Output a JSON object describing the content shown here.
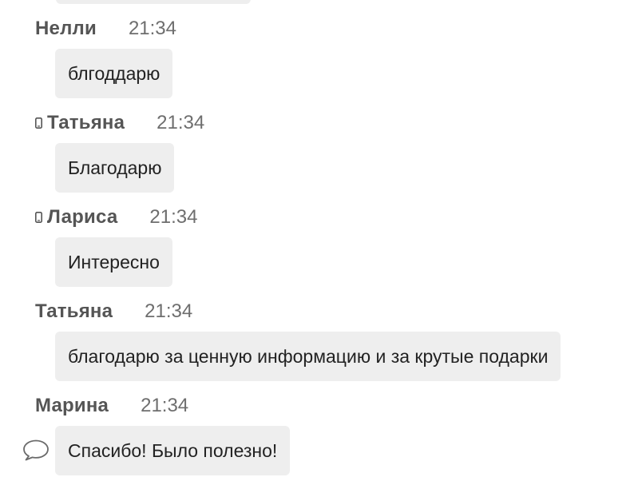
{
  "messages": [
    {
      "author": "Нелли",
      "time": "21:34",
      "text": "блгоддарю",
      "mobile": false
    },
    {
      "author": "Татьяна",
      "time": "21:34",
      "text": "Благодарю",
      "mobile": true
    },
    {
      "author": "Лариса",
      "time": "21:34",
      "text": "Интересно",
      "mobile": true
    },
    {
      "author": "Татьяна",
      "time": "21:34",
      "text": "благодарю за ценную информацию и за крутые подарки",
      "mobile": false
    },
    {
      "author": "Марина",
      "time": "21:34",
      "text": "Спасибо! Было полезно!",
      "mobile": false
    }
  ],
  "icons": {
    "mobile": "mobile-phone-icon",
    "reply": "speech-bubble-icon"
  },
  "colors": {
    "bubble_bg": "#eeeeee",
    "author": "#555555",
    "time": "#6e6e6e",
    "text": "#222222"
  }
}
